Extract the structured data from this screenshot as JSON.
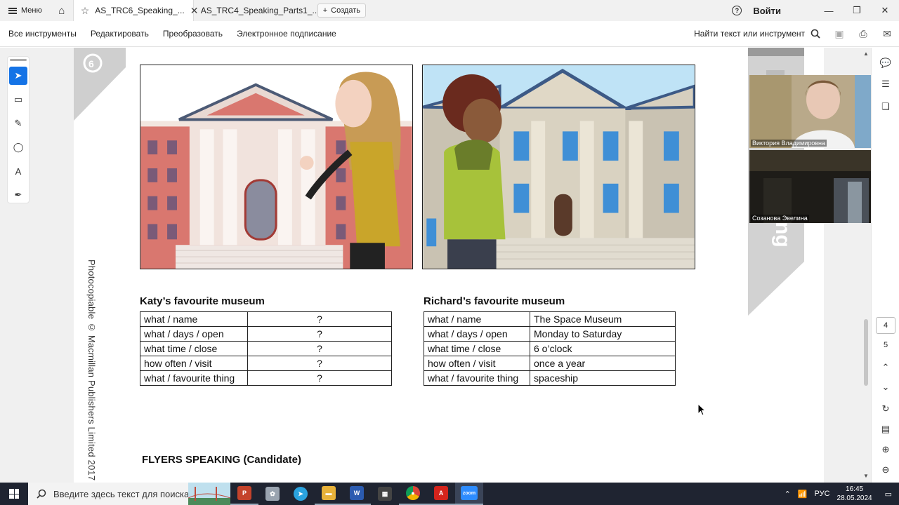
{
  "titlebar": {
    "menu_label": "Меню",
    "tabs": [
      {
        "label": "AS_TRC6_Speaking_..."
      },
      {
        "label": "AS_TRC4_Speaking_Parts1_..."
      }
    ],
    "create_label": "Создать",
    "signin_label": "Войти"
  },
  "toolbar": {
    "items": [
      "Все инструменты",
      "Редактировать",
      "Преобразовать",
      "Электронное подписание"
    ],
    "find_label": "Найти текст или инструмент"
  },
  "document": {
    "left_heading": "Katy’s favourite museum",
    "right_heading": "Richard’s favourite museum",
    "left_table": [
      {
        "q": "what / name",
        "a": "?"
      },
      {
        "q": "what / days / open",
        "a": "?"
      },
      {
        "q": "what time / close",
        "a": "?"
      },
      {
        "q": "how often / visit",
        "a": "?"
      },
      {
        "q": "what / favourite thing",
        "a": "?"
      }
    ],
    "right_table": [
      {
        "q": "what / name",
        "a": "The Space Museum"
      },
      {
        "q": "what / days / open",
        "a": "Monday to Saturday"
      },
      {
        "q": "what time / close",
        "a": "6 o’clock"
      },
      {
        "q": "how often / visit",
        "a": "once a year"
      },
      {
        "q": "what / favourite thing",
        "a": "spaceship"
      }
    ],
    "copyright": "Photocopiable © Macmillan Publishers Limited 2017",
    "footer_title": "FLYERS SPEAKING (Candidate)"
  },
  "video": {
    "participant1": "Виктория Владимировна",
    "participant2": "Созанова Эвелина"
  },
  "pages": {
    "current": "4",
    "next": "5"
  },
  "taskbar": {
    "search_placeholder": "Введите здесь текст для поиска",
    "lang": "РУС",
    "time": "16:45",
    "date": "28.05.2024"
  },
  "colors": {
    "accent": "#1473e6",
    "brick": "#d9776f",
    "stone": "#c9c2b2"
  }
}
